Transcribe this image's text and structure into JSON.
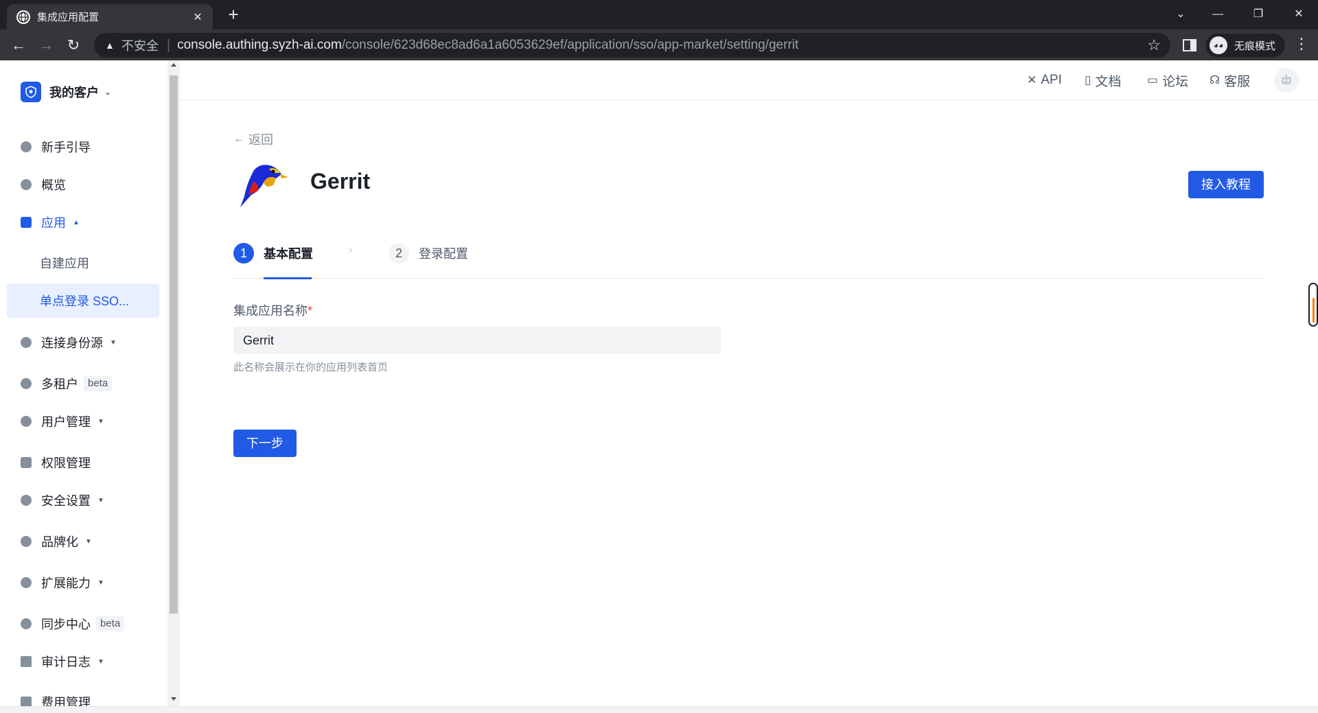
{
  "browser": {
    "tab_title": "集成应用配置",
    "insecure_label": "不安全",
    "url_domain": "console.authing.syzh-ai.com",
    "url_path": "/console/623d68ec8ad6a1a6053629ef/application/sso/app-market/setting/gerrit",
    "incognito_label": "无痕模式"
  },
  "sidebar": {
    "brand": "我的客户",
    "items": [
      {
        "label": "新手引导"
      },
      {
        "label": "概览"
      },
      {
        "label": "应用"
      },
      {
        "label": "自建应用"
      },
      {
        "label": "单点登录 SSO..."
      },
      {
        "label": "连接身份源"
      },
      {
        "label": "多租户",
        "badge": "beta"
      },
      {
        "label": "用户管理"
      },
      {
        "label": "权限管理"
      },
      {
        "label": "安全设置"
      },
      {
        "label": "品牌化"
      },
      {
        "label": "扩展能力"
      },
      {
        "label": "同步中心",
        "badge": "beta"
      },
      {
        "label": "审计日志"
      },
      {
        "label": "费用管理"
      }
    ]
  },
  "topbar": {
    "api": "API",
    "docs": "文档",
    "forum": "论坛",
    "support": "客服"
  },
  "main": {
    "back": "返回",
    "app_name": "Gerrit",
    "tutorial_button": "接入教程",
    "steps": [
      {
        "num": "1",
        "label": "基本配置"
      },
      {
        "num": "2",
        "label": "登录配置"
      }
    ],
    "field_label": "集成应用名称",
    "field_required": "*",
    "field_value": "Gerrit",
    "field_hint": "此名称会展示在你的应用列表首页",
    "next_button": "下一步"
  },
  "colors": {
    "primary": "#215ae5",
    "chrome_dark": "#202124",
    "chrome_mid": "#35363a"
  }
}
